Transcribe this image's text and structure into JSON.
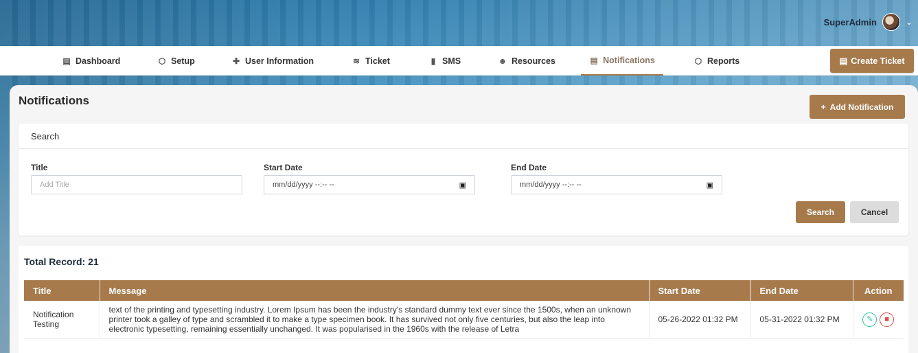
{
  "header": {
    "user_name": "SuperAdmin"
  },
  "nav": {
    "items": [
      {
        "label": "Dashboard",
        "icon": "dashboard-icon"
      },
      {
        "label": "Setup",
        "icon": "box-icon"
      },
      {
        "label": "User Information",
        "icon": "user-plus-icon"
      },
      {
        "label": "Ticket",
        "icon": "line-chart-icon"
      },
      {
        "label": "SMS",
        "icon": "message-icon"
      },
      {
        "label": "Resources",
        "icon": "smiley-icon"
      },
      {
        "label": "Notifications",
        "icon": "document-icon",
        "active": true
      },
      {
        "label": "Reports",
        "icon": "cube-icon"
      }
    ],
    "create_ticket_label": "Create Ticket"
  },
  "page": {
    "title": "Notifications",
    "add_label": "Add Notification"
  },
  "search": {
    "heading": "Search",
    "title_label": "Title",
    "title_placeholder": "Add Title",
    "start_label": "Start Date",
    "start_value": "mm/dd/yyyy --:-- --",
    "end_label": "End Date",
    "end_value": "mm/dd/yyyy --:-- --",
    "search_label": "Search",
    "cancel_label": "Cancel"
  },
  "table": {
    "total_label": "Total Record: 21",
    "columns": [
      "Title",
      "Message",
      "Start Date",
      "End Date",
      "Action"
    ],
    "rows": [
      {
        "title": "Notification Testing",
        "message": "text of the printing and typesetting industry. Lorem Ipsum has been the industry's standard dummy text ever since the 1500s, when an unknown printer took a galley of type and scrambled it to make a type specimen book. It has survived not only five centuries, but also the leap into electronic typesetting, remaining essentially unchanged. It was popularised in the 1960s with the release of Letra",
        "start": "05-26-2022 01:32 PM",
        "end": "05-31-2022 01:32 PM"
      }
    ]
  },
  "colors": {
    "accent": "#a77a4c",
    "edit": "#26c6a6",
    "delete": "#e04848"
  }
}
